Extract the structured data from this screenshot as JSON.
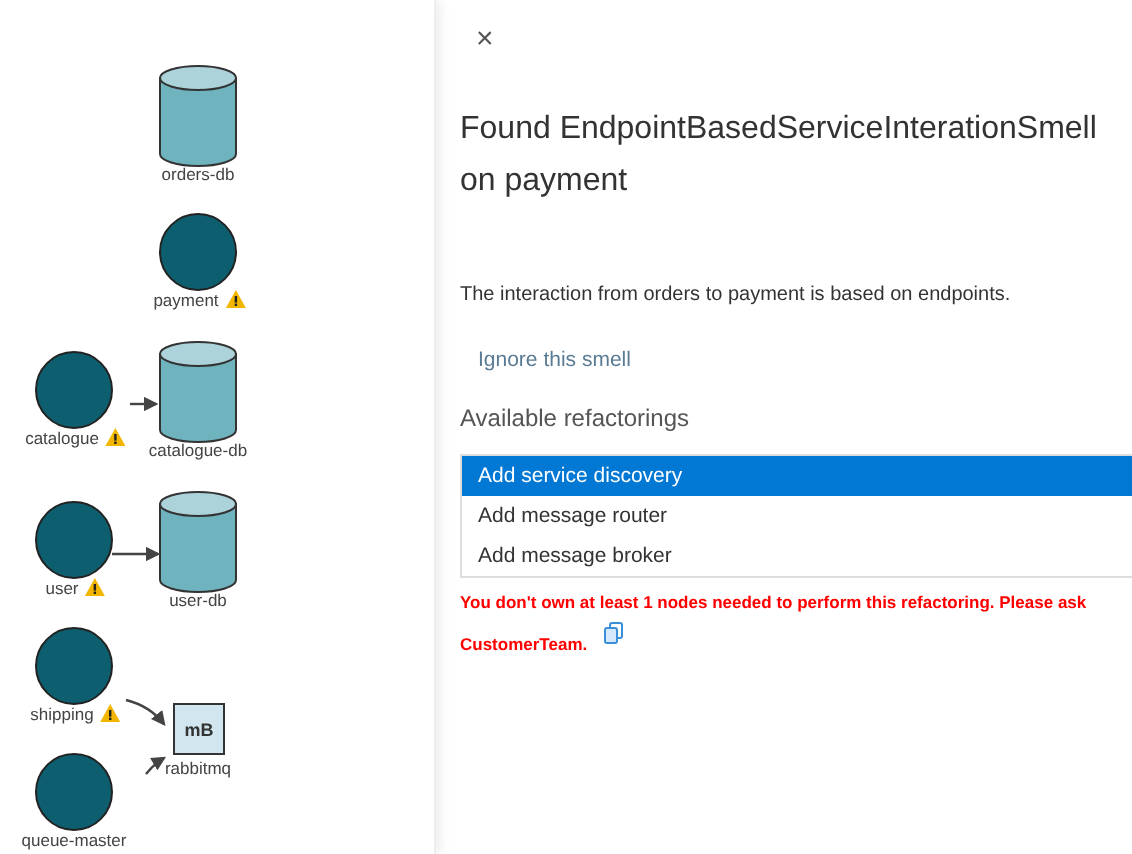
{
  "diagram": {
    "nodes": [
      {
        "kind": "database",
        "label": "orders-db",
        "warning": false
      },
      {
        "kind": "service",
        "label": "payment",
        "warning": true
      },
      {
        "kind": "service",
        "label": "catalogue",
        "warning": true
      },
      {
        "kind": "database",
        "label": "catalogue-db",
        "warning": false
      },
      {
        "kind": "service",
        "label": "user",
        "warning": true
      },
      {
        "kind": "database",
        "label": "user-db",
        "warning": false
      },
      {
        "kind": "service",
        "label": "shipping",
        "warning": true
      },
      {
        "kind": "broker",
        "label": "rabbitmq",
        "icon_text": "mB",
        "warning": false
      },
      {
        "kind": "service",
        "label": "queue-master",
        "warning": false
      }
    ]
  },
  "panel": {
    "close": "×",
    "title": "Found EndpointBasedServiceInterationSmell on payment",
    "description": "The interaction from orders to payment is based on endpoints.",
    "ignore_link": "Ignore this smell",
    "refactorings_label": "Available refactorings",
    "refactorings": [
      {
        "label": "Add service discovery",
        "selected": true
      },
      {
        "label": "Add message router",
        "selected": false
      },
      {
        "label": "Add message broker",
        "selected": false
      }
    ],
    "error_lines": [
      "You don't own at least 1 nodes needed to perform this refactoring. Please ask",
      "CustomerTeam."
    ]
  }
}
